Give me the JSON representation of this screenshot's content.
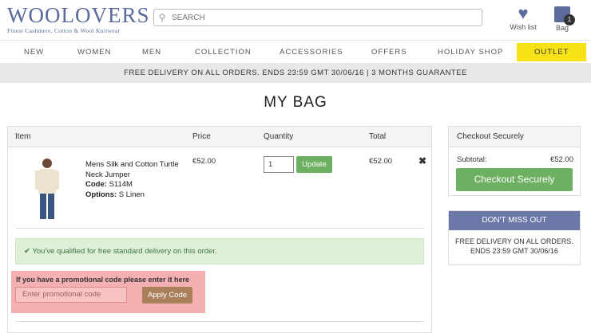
{
  "header": {
    "brand": "WOOLOVERS",
    "tagline": "Finest Cashmere, Cotton & Wool Knitwear",
    "search_placeholder": "SEARCH",
    "wishlist_label": "Wish list",
    "bag_label": "Bag",
    "bag_count": "1"
  },
  "nav": {
    "items": [
      "NEW",
      "WOMEN",
      "MEN",
      "COLLECTION",
      "ACCESSORIES",
      "OFFERS",
      "HOLIDAY SHOP"
    ],
    "outlet": "OUTLET"
  },
  "promo_bar": "FREE DELIVERY ON ALL ORDERS. ENDS 23:59 GMT 30/06/16   |   3 MONTHS GUARANTEE",
  "page_title": "MY BAG",
  "table": {
    "headers": {
      "item": "Item",
      "price": "Price",
      "quantity": "Quantity",
      "total": "Total"
    },
    "row": {
      "name": "Mens Silk and Cotton Turtle Neck Jumper",
      "code_label": "Code:",
      "code": "S114M",
      "options_label": "Options:",
      "options": "S Linen",
      "price": "€52.00",
      "quantity": "1",
      "update_label": "Update",
      "total": "€52.00",
      "remove": "✖"
    }
  },
  "qualify_message": "You've qualified for free standard delivery on this order.",
  "promo_code": {
    "label": "If you have a promotional code please enter it here",
    "placeholder": "Enter promotional code",
    "apply_label": "Apply Code"
  },
  "checkout": {
    "title": "Checkout Securely",
    "subtotal_label": "Subtotal:",
    "subtotal_value": "€52.00",
    "button_label": "Checkout Securely"
  },
  "dont_miss": {
    "title": "DON'T MISS OUT",
    "line1": "FREE DELIVERY ON ALL ORDERS.",
    "line2": "ENDS 23:59 GMT 30/06/16"
  },
  "colors": {
    "brand": "#5a6b9c",
    "green": "#6eb062",
    "outlet": "#f7e217",
    "promo_bg": "#f5b1b1"
  }
}
